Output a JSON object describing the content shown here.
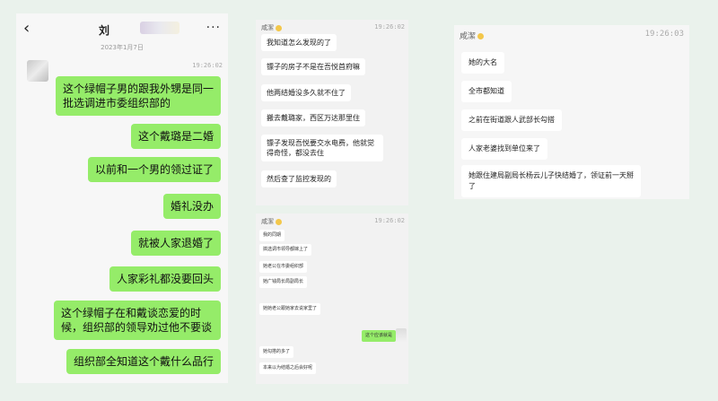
{
  "panel1": {
    "back_icon": "chevron-left-icon",
    "title": "刘",
    "more_icon": "ellipsis-icon",
    "date": "2023年1月7日",
    "time": "19:26:02",
    "messages": [
      "这个绿帽子男的跟我外甥是同一批选调进市委组织部的",
      "这个戴璐是二婚",
      "以前和一个男的领过证了",
      "婚礼没办",
      "就被人家退婚了",
      "人家彩礼都没要回头",
      "这个绿帽子在和戴谈恋爱的时候，组织部的领导劝过他不要谈",
      "组织部全知道这个戴什么品行"
    ]
  },
  "panel2": {
    "sender": "咸潔",
    "time": "19:26:02",
    "messages": [
      "我知道怎么发现的了",
      "镖子的房子不是在吾悦首府嘛",
      "他两结婚没多久就不住了",
      "搬去戴璐家，西区万达那里住",
      "镖子发现吾悦要交水电费，他就觉得奇怪，都没去住",
      "然后查了监控发现的"
    ]
  },
  "panel3": {
    "sender": "咸潔",
    "time": "19:26:02",
    "messages": [
      "我的同期",
      "搞选调市领导都嫁上了",
      "她老公在市委组织部",
      "她广钱局长局副局长",
      "她她老公跟她家去说家里了",
      "她勾搭的多了",
      "本来以为结婚之后会好呢"
    ],
    "reply": "这个应该就是"
  },
  "panel4": {
    "sender": "咸潔",
    "time": "19:26:03",
    "messages": [
      "她的大名",
      "全市都知道",
      "之前在街道跟人武部长勾搭",
      "人家老婆找到单位来了",
      "她跟住建局副局长杨云儿子快结婚了，领证前一天掰了"
    ]
  }
}
